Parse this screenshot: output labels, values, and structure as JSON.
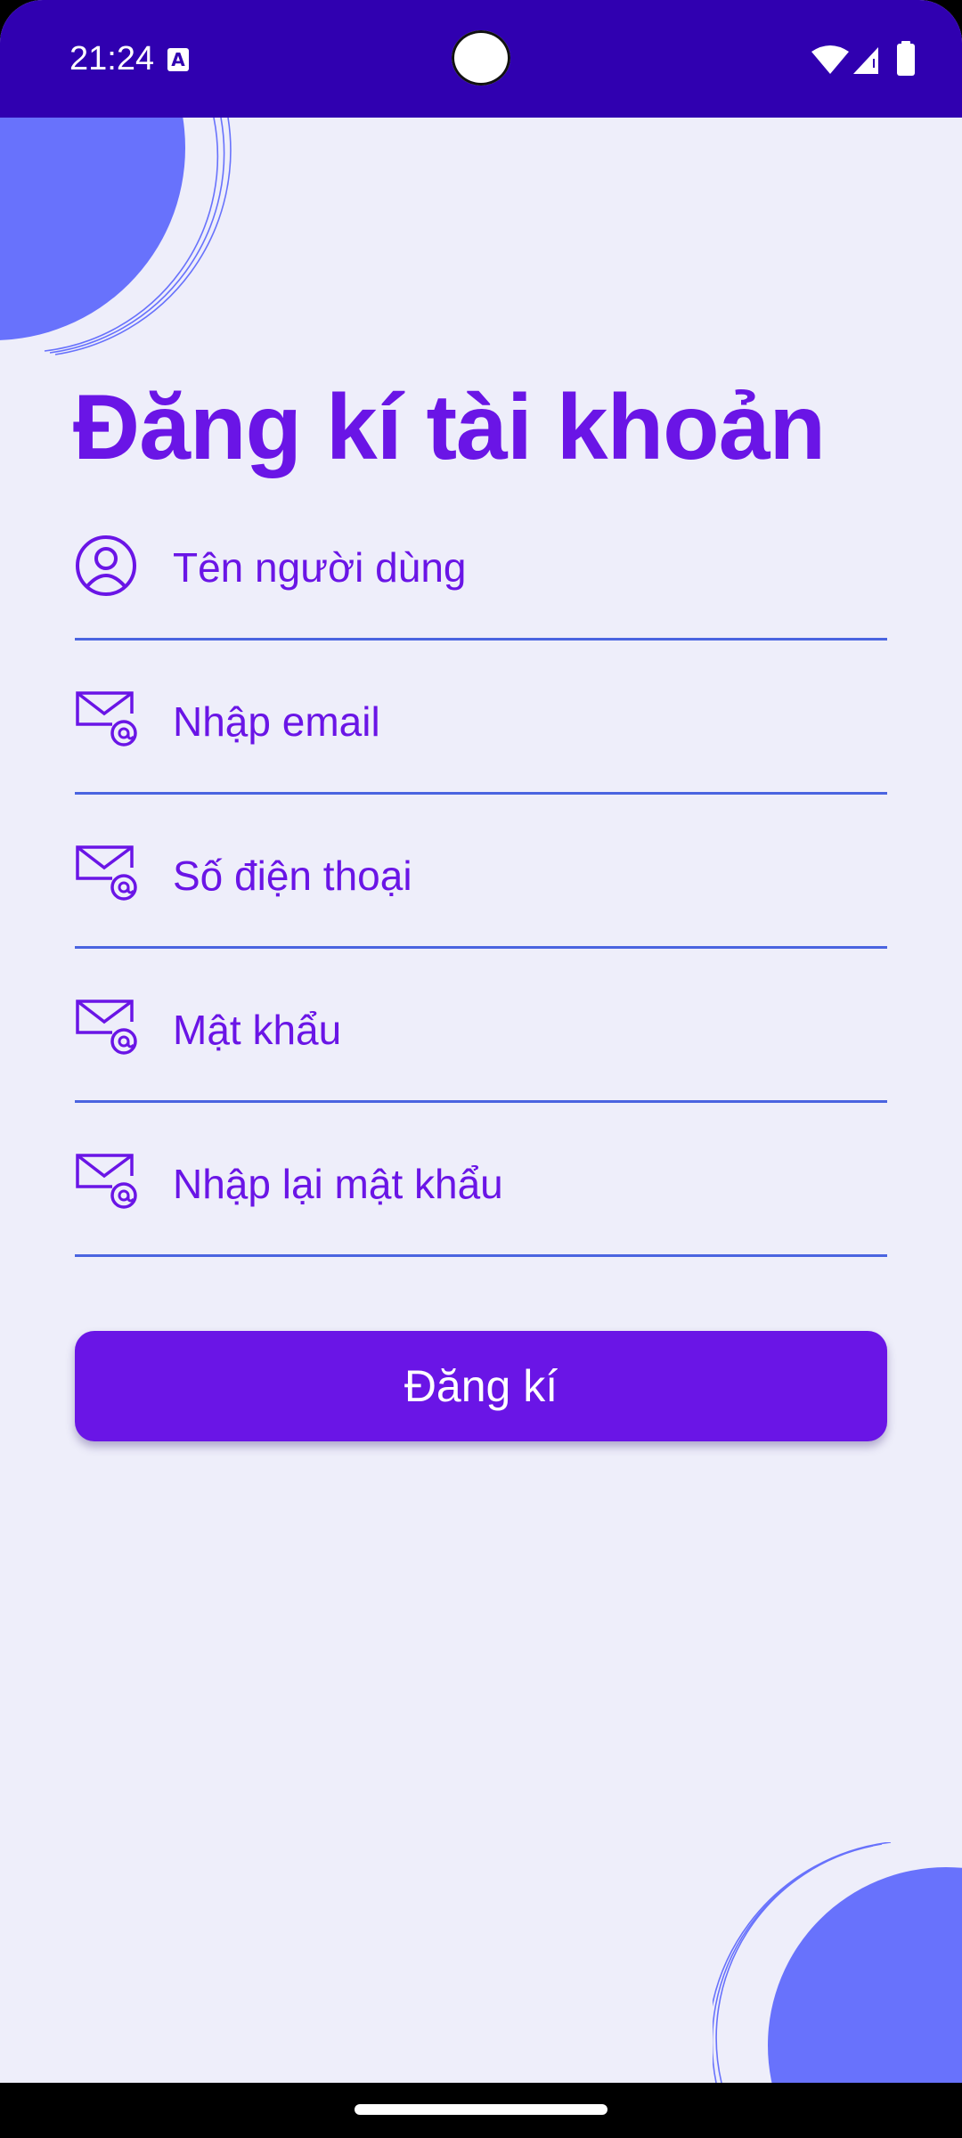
{
  "status_bar": {
    "time": "21:24",
    "notification_icon": "a-box-icon",
    "icons": [
      "wifi-icon",
      "signal-icon",
      "battery-icon"
    ],
    "background": "#3000B0"
  },
  "page": {
    "title": "Đăng kí tài khoản"
  },
  "form": {
    "username_placeholder": "Tên người dùng",
    "email_placeholder": "Nhập email",
    "phone_placeholder": "Số điện thoại",
    "password_placeholder": "Mật khẩu",
    "confirm_password_placeholder": "Nhập lại mật khẩu",
    "submit_label": "Đăng kí"
  },
  "colors": {
    "accent": "#6A15E6",
    "field_underline": "#4A64E0",
    "decoration": "#6872FC",
    "background": "#EEEEFA"
  }
}
